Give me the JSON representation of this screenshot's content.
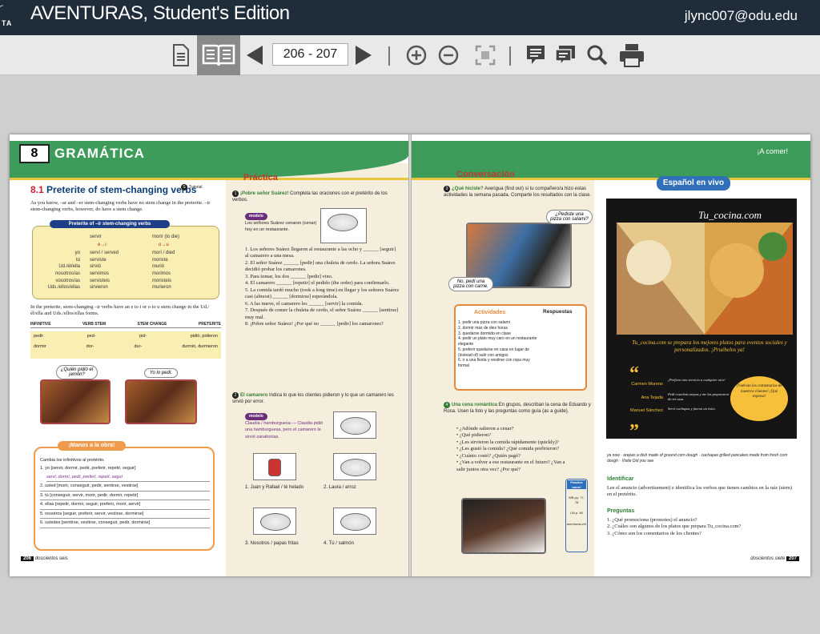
{
  "app": {
    "title": "AVENTURAS, Student's Edition",
    "user_email": "jlync007@odu.edu",
    "logo_text": "TA"
  },
  "toolbar": {
    "page_value": "206 - 207"
  },
  "book": {
    "chapter_number": "8",
    "chapter_title": "GRAMÁTICA",
    "header_right": "¡A comer!",
    "left": {
      "section_title": "Preterite of stem-changing verbs",
      "section_num": "8.1",
      "tutorial": "Tutorial",
      "intro": "As you know, –ar and –er stem-changing verbs have no stem change in the preterite. –ir stem-changing verbs, however, do have a stem change.",
      "chart_title": "Preterite of –ir stem-changing verbs",
      "chart": {
        "head1": "servir",
        "head2": "morir (to die)",
        "chg1": "e→i",
        "chg2": "o→u",
        "pronouns": [
          "yo",
          "tú",
          "Ud./él/ella",
          "nosotros/as",
          "vosotros/as",
          "Uds./ellos/ellas"
        ],
        "servir": [
          "serví / served",
          "serviste",
          "sirvió",
          "servimos",
          "servisteis",
          "sirvieron"
        ],
        "morir": [
          "morí / died",
          "moriste",
          "murió",
          "morimos",
          "moristeis",
          "murieron"
        ]
      },
      "note": "In the preterite, stem-changing –ir verbs have an e to i or o to u stem change in the Ud./él/ella and Uds./ellos/ellas forms.",
      "table_heads": [
        "INFINITIVE",
        "VERB STEM",
        "STEM CHANGE",
        "PRETERITE"
      ],
      "table_rows": [
        [
          "pedir",
          "ped-",
          "pid-",
          "pidió, pidieron"
        ],
        [
          "dormir",
          "dor-",
          "dur-",
          "durmió, durmieron"
        ]
      ],
      "bubble1": "¿Quién pidió el jamón?",
      "bubble2": "Yo lo pedí.",
      "manos_title": "¡Manos a la obra!",
      "manos_intro": "Cambia los infinitivos al pretérito.",
      "manos_items": [
        "1. yo [servir, dormir, pedir, preferir, repetir, seguir]",
        "servi, dormí, pedí, preferí, repetí, seguí",
        "2. usted [morir, conseguir, pedir, sentirse, vestirse]",
        "3. tú [conseguir, servir, morir, pedir, dormir, repetir]",
        "4. ellas [repetir, dormir, seguir, preferir, morir, servir]",
        "5. nosotros [seguir, preferir, servir, vestirse, dormirse]",
        "6. ustedes [sentirse, vestirse, conseguir, pedir, dormirse]"
      ],
      "footer_page": "206",
      "footer_text": "doscientos seis"
    },
    "practica": {
      "title": "Práctica",
      "ex1_title": "¡Pobre señor Suárez!",
      "ex1_instr": "Completa las oraciones con el pretérito de los verbos.",
      "modelo": "modelo",
      "ex1_model": "Los señores Suárez cenaron (cenar) hoy en un restaurante.",
      "ex1_items": [
        "1. Los señores Suárez llegaron al restaurante a las ocho y ______ [seguir] al camarero a una mesa.",
        "2. El señor Suárez ______ [pedir] una chuleta de cerdo. La señora Suárez decidió probar los camarones.",
        "3. Para tomar, los dos ______ [pedir] vino.",
        "4. El camarero ______ [repetir] el pedido (the order) para confirmarlo.",
        "5. La comida tardó mucho (took a long time) en llegar y los señores Suárez casi (almost) ______ [dormirse] esperándola.",
        "6. A las nueve, el camarero les ______ [servir] la comida.",
        "7. Después de comer la chuleta de cerdo, el señor Suárez ______ [sentirse] muy mal.",
        "8. ¡Pobre señor Suárez! ¿Por qué no ______ [pedir] los camarones?"
      ],
      "ex2_title": "El camarero",
      "ex2_instr": "Indica lo que los clientes pidieron y lo que un camarero les sirvió por error.",
      "ex2_model": "Claudia / hamburguesa — Claudia pidió una hamburguesa, pero el camarero le sirvió zanahorias.",
      "ex2_items": [
        "1. Juan y Rafael / té helado",
        "2. Laura / arroz",
        "3. Nosotros / papas fritas",
        "4. Tú / salmón"
      ]
    },
    "conversacion": {
      "title": "Conversación",
      "ex3_title": "¿Qué hiciste?",
      "ex3_instr": "Averigua (find out) si tu compañero/a hizo estas actividades la semana pasada. Comparte los resultados con la clase.",
      "bubble_a": "¿Pediste una pizza con salami?",
      "bubble_b": "No, pedí una pizza con carne.",
      "acts_head": "Actividades",
      "resp_head": "Respuestas",
      "acts": [
        "1. pedir una pizza con salami",
        "2. dormir más de diez horas",
        "3. quedarse dormido en clase",
        "4. pedir un plato muy caro en un restaurante elegante",
        "5. preferir quedarse en casa en lugar de (instead of) salir con amigos",
        "6. ir a una fiesta y vestirse con ropa muy formal"
      ],
      "ex4_title": "Una cena romántica",
      "ex4_instr": "En grupos, describan la cena de Eduardo y Rosa. Usen la foto y las preguntas como guía (as a guide).",
      "ex4_items": [
        "• ¿Adónde salieron a cenar?",
        "• ¿Qué pidieron?",
        "• ¿Les sirvieron la comida rápidamente (quickly)?",
        "• ¿Les gustó la comida? ¿Qué comida prefirieron?",
        "• ¿Cuánto costó? ¿Quién pagó?",
        "• ¿Van a volver a ese restaurante en el futuro? ¿Van a salir juntos otra vez? ¿Por qué?"
      ],
      "practice_label": "Practice more!",
      "practice_items": [
        "WB pp. 77-78",
        "LM p. 46",
        "aventuras.vhlcentral.com"
      ]
    },
    "vivo": {
      "title": "Español en vivo",
      "ad_brand": "Tu_cocina.com",
      "ad_tag": "Tu_cocina.com se prepara los mejores platos para eventos sociales y personalizados. ¡Pruébelos ya!",
      "names": [
        "Carmen Moreno",
        "Ana Tejada",
        "Manuel Sánchez"
      ],
      "quotes": [
        "¡Prefiero este servicio a cualquier otro!",
        "Pedí costeleta arepas y me las prepararon de mi casa.",
        "Serví cachapas y fueron un éxito."
      ],
      "badge": "¡Vuelvan los comentarios de nuestros clientes! ¡Qué esperas!",
      "vocab": "ya now · arepas a dish made of ground corn dough · cachapas grilled pancakes made from fresh corn dough · Visite Did you see",
      "ident_title": "Identificar",
      "ident_text": "Lee el anuncio (advertisement) e identifica los verbos que tienen cambios en la raíz (stem) en el pretérito.",
      "preg_title": "Preguntas",
      "preg_items": [
        "1. ¿Qué promociona (promotes) el anuncio?",
        "2. ¿Cuáles son algunos de los platos que prepara Tu_cocina.com?",
        "3. ¿Cómo son los comentarios de los clientes?"
      ],
      "footer_text": "doscientos siete",
      "footer_page": "207"
    }
  }
}
